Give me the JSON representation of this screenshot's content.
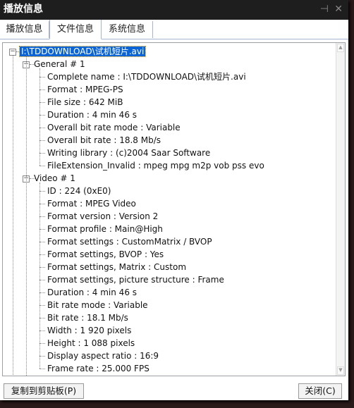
{
  "title": "播放信息",
  "tabs": [
    {
      "label": "播放信息"
    },
    {
      "label": "文件信息"
    },
    {
      "label": "系统信息"
    }
  ],
  "tree": {
    "root": "I:\\TDDOWNLOAD\\试机短片.avi",
    "general": {
      "label": "General # 1",
      "items": [
        "Complete name : I:\\TDDOWNLOAD\\试机短片.avi",
        "Format : MPEG-PS",
        "File size : 642 MiB",
        "Duration : 4 min 46 s",
        "Overall bit rate mode : Variable",
        "Overall bit rate : 18.8 Mb/s",
        "Writing library : (c)2004 Saar Software",
        "FileExtension_Invalid : mpeg mpg m2p vob pss evo"
      ]
    },
    "video": {
      "label": "Video # 1",
      "items": [
        "ID : 224 (0xE0)",
        "Format : MPEG Video",
        "Format version : Version 2",
        "Format profile : Main@High",
        "Format settings : CustomMatrix / BVOP",
        "Format settings, BVOP : Yes",
        "Format settings, Matrix : Custom",
        "Format settings, picture structure : Frame",
        "Duration : 4 min 46 s",
        "Bit rate mode : Variable",
        "Bit rate : 18.1 Mb/s",
        "Width : 1 920 pixels",
        "Height : 1 088 pixels",
        "Display aspect ratio : 16:9",
        "Frame rate : 25.000 FPS"
      ]
    }
  },
  "buttons": {
    "copy": "复制到剪贴板(P)",
    "close": "关闭(C)"
  },
  "colors": {
    "selection": "#0a64d6",
    "titlebar": "#1e1e1e"
  }
}
